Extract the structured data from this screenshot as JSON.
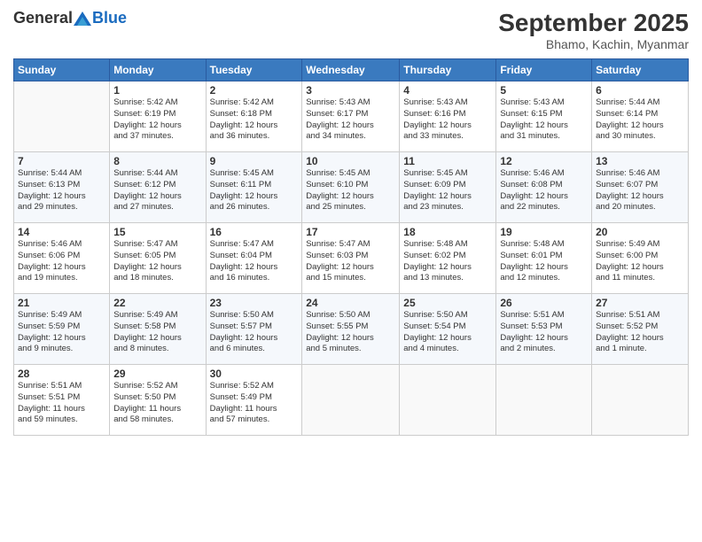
{
  "header": {
    "logo_general": "General",
    "logo_blue": "Blue",
    "month_title": "September 2025",
    "location": "Bhamo, Kachin, Myanmar"
  },
  "days_of_week": [
    "Sunday",
    "Monday",
    "Tuesday",
    "Wednesday",
    "Thursday",
    "Friday",
    "Saturday"
  ],
  "weeks": [
    [
      {
        "day": "",
        "info": ""
      },
      {
        "day": "1",
        "info": "Sunrise: 5:42 AM\nSunset: 6:19 PM\nDaylight: 12 hours\nand 37 minutes."
      },
      {
        "day": "2",
        "info": "Sunrise: 5:42 AM\nSunset: 6:18 PM\nDaylight: 12 hours\nand 36 minutes."
      },
      {
        "day": "3",
        "info": "Sunrise: 5:43 AM\nSunset: 6:17 PM\nDaylight: 12 hours\nand 34 minutes."
      },
      {
        "day": "4",
        "info": "Sunrise: 5:43 AM\nSunset: 6:16 PM\nDaylight: 12 hours\nand 33 minutes."
      },
      {
        "day": "5",
        "info": "Sunrise: 5:43 AM\nSunset: 6:15 PM\nDaylight: 12 hours\nand 31 minutes."
      },
      {
        "day": "6",
        "info": "Sunrise: 5:44 AM\nSunset: 6:14 PM\nDaylight: 12 hours\nand 30 minutes."
      }
    ],
    [
      {
        "day": "7",
        "info": "Sunrise: 5:44 AM\nSunset: 6:13 PM\nDaylight: 12 hours\nand 29 minutes."
      },
      {
        "day": "8",
        "info": "Sunrise: 5:44 AM\nSunset: 6:12 PM\nDaylight: 12 hours\nand 27 minutes."
      },
      {
        "day": "9",
        "info": "Sunrise: 5:45 AM\nSunset: 6:11 PM\nDaylight: 12 hours\nand 26 minutes."
      },
      {
        "day": "10",
        "info": "Sunrise: 5:45 AM\nSunset: 6:10 PM\nDaylight: 12 hours\nand 25 minutes."
      },
      {
        "day": "11",
        "info": "Sunrise: 5:45 AM\nSunset: 6:09 PM\nDaylight: 12 hours\nand 23 minutes."
      },
      {
        "day": "12",
        "info": "Sunrise: 5:46 AM\nSunset: 6:08 PM\nDaylight: 12 hours\nand 22 minutes."
      },
      {
        "day": "13",
        "info": "Sunrise: 5:46 AM\nSunset: 6:07 PM\nDaylight: 12 hours\nand 20 minutes."
      }
    ],
    [
      {
        "day": "14",
        "info": "Sunrise: 5:46 AM\nSunset: 6:06 PM\nDaylight: 12 hours\nand 19 minutes."
      },
      {
        "day": "15",
        "info": "Sunrise: 5:47 AM\nSunset: 6:05 PM\nDaylight: 12 hours\nand 18 minutes."
      },
      {
        "day": "16",
        "info": "Sunrise: 5:47 AM\nSunset: 6:04 PM\nDaylight: 12 hours\nand 16 minutes."
      },
      {
        "day": "17",
        "info": "Sunrise: 5:47 AM\nSunset: 6:03 PM\nDaylight: 12 hours\nand 15 minutes."
      },
      {
        "day": "18",
        "info": "Sunrise: 5:48 AM\nSunset: 6:02 PM\nDaylight: 12 hours\nand 13 minutes."
      },
      {
        "day": "19",
        "info": "Sunrise: 5:48 AM\nSunset: 6:01 PM\nDaylight: 12 hours\nand 12 minutes."
      },
      {
        "day": "20",
        "info": "Sunrise: 5:49 AM\nSunset: 6:00 PM\nDaylight: 12 hours\nand 11 minutes."
      }
    ],
    [
      {
        "day": "21",
        "info": "Sunrise: 5:49 AM\nSunset: 5:59 PM\nDaylight: 12 hours\nand 9 minutes."
      },
      {
        "day": "22",
        "info": "Sunrise: 5:49 AM\nSunset: 5:58 PM\nDaylight: 12 hours\nand 8 minutes."
      },
      {
        "day": "23",
        "info": "Sunrise: 5:50 AM\nSunset: 5:57 PM\nDaylight: 12 hours\nand 6 minutes."
      },
      {
        "day": "24",
        "info": "Sunrise: 5:50 AM\nSunset: 5:55 PM\nDaylight: 12 hours\nand 5 minutes."
      },
      {
        "day": "25",
        "info": "Sunrise: 5:50 AM\nSunset: 5:54 PM\nDaylight: 12 hours\nand 4 minutes."
      },
      {
        "day": "26",
        "info": "Sunrise: 5:51 AM\nSunset: 5:53 PM\nDaylight: 12 hours\nand 2 minutes."
      },
      {
        "day": "27",
        "info": "Sunrise: 5:51 AM\nSunset: 5:52 PM\nDaylight: 12 hours\nand 1 minute."
      }
    ],
    [
      {
        "day": "28",
        "info": "Sunrise: 5:51 AM\nSunset: 5:51 PM\nDaylight: 11 hours\nand 59 minutes."
      },
      {
        "day": "29",
        "info": "Sunrise: 5:52 AM\nSunset: 5:50 PM\nDaylight: 11 hours\nand 58 minutes."
      },
      {
        "day": "30",
        "info": "Sunrise: 5:52 AM\nSunset: 5:49 PM\nDaylight: 11 hours\nand 57 minutes."
      },
      {
        "day": "",
        "info": ""
      },
      {
        "day": "",
        "info": ""
      },
      {
        "day": "",
        "info": ""
      },
      {
        "day": "",
        "info": ""
      }
    ]
  ]
}
